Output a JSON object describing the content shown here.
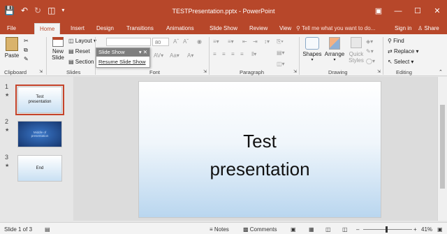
{
  "window": {
    "title": "TESTPresentation.pptx - PowerPoint"
  },
  "qat": {
    "save_icon": "save-icon",
    "undo_icon": "undo-icon",
    "redo_icon": "redo-icon",
    "start_icon": "start-from-beginning-icon"
  },
  "tabs": [
    {
      "label": "File"
    },
    {
      "label": "Home"
    },
    {
      "label": "Insert"
    },
    {
      "label": "Design"
    },
    {
      "label": "Transitions"
    },
    {
      "label": "Animations"
    },
    {
      "label": "Slide Show"
    },
    {
      "label": "Review"
    },
    {
      "label": "View"
    }
  ],
  "tell_me": "Tell me what you want to do...",
  "sign_in": "Sign in",
  "share": "Share",
  "ribbon": {
    "clipboard": {
      "paste": "Paste",
      "label": "Clipboard"
    },
    "slides": {
      "new_slide_1": "New",
      "new_slide_2": "Slide",
      "layout": "Layout",
      "reset": "Reset",
      "section": "Section",
      "label": "Slides"
    },
    "font": {
      "size": "80",
      "label": "Font"
    },
    "paragraph": {
      "label": "Paragraph"
    },
    "drawing": {
      "shapes": "Shapes",
      "arrange": "Arrange",
      "quick_1": "Quick",
      "quick_2": "Styles",
      "label": "Drawing"
    },
    "editing": {
      "find": "Find",
      "replace": "Replace",
      "select": "Select",
      "label": "Editing"
    }
  },
  "slideshow_popup": {
    "title": "Slide Show",
    "link": "Resume Slide Show"
  },
  "thumbnails": [
    {
      "num": "1",
      "text": "Test presentation"
    },
    {
      "num": "2",
      "text": "Middle of presentation"
    },
    {
      "num": "3",
      "text": "End"
    }
  ],
  "slide": {
    "line1": "Test",
    "line2": "presentation"
  },
  "status": {
    "slide_of": "Slide 1 of 3",
    "notes": "Notes",
    "comments": "Comments",
    "zoom": "41%"
  },
  "colors": {
    "accent": "#b7472a",
    "selection": "#c5432a"
  }
}
